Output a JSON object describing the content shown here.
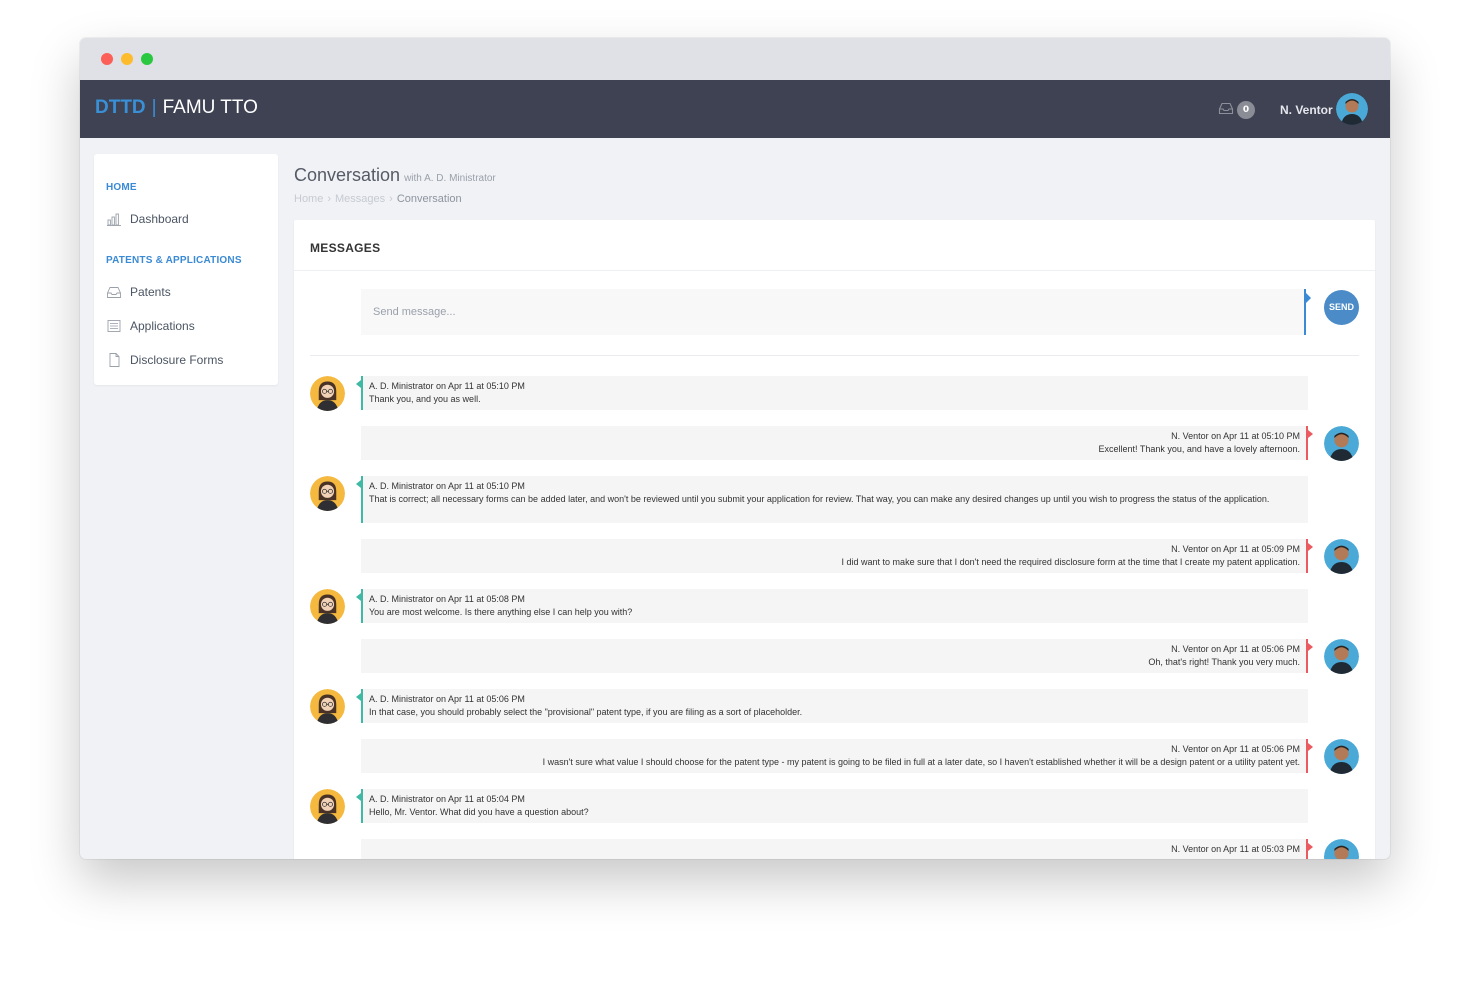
{
  "window": {
    "controls": [
      "close",
      "minimize",
      "maximize"
    ]
  },
  "navbar": {
    "brand_primary": "DTTD",
    "brand_separator": "|",
    "brand_secondary": "FAMU TTO",
    "inbox_icon": "inbox-icon",
    "inbox_count": "0",
    "user_name": "N. Ventor"
  },
  "sidebar": {
    "sections": [
      {
        "title": "HOME",
        "items": [
          {
            "label": "Dashboard",
            "icon": "bar-chart-icon"
          }
        ]
      },
      {
        "title": "PATENTS & APPLICATIONS",
        "items": [
          {
            "label": "Patents",
            "icon": "inbox-icon"
          },
          {
            "label": "Applications",
            "icon": "newspaper-icon"
          },
          {
            "label": "Disclosure Forms",
            "icon": "document-icon"
          }
        ]
      }
    ]
  },
  "page": {
    "title": "Conversation",
    "subtitle": "with A. D. Ministrator",
    "breadcrumb": [
      "Home",
      "Messages",
      "Conversation"
    ]
  },
  "panel": {
    "title": "MESSAGES",
    "compose_placeholder": "Send message...",
    "send_label": "SEND"
  },
  "colors": {
    "navbar": "#3e4253",
    "brand_blue": "#3a90d6",
    "received_accent": "#3fb9a4",
    "sent_accent": "#ea5a5f",
    "send_button": "#4a8bc8"
  },
  "messages": [
    {
      "side": "left",
      "meta": "A. D. Ministrator on Apr 11 at 05:10 PM",
      "text": "Thank you, and you as well."
    },
    {
      "side": "right",
      "meta": "N. Ventor on Apr 11 at 05:10 PM",
      "text": "Excellent! Thank you, and have a lovely afternoon."
    },
    {
      "side": "left",
      "meta": "A. D. Ministrator on Apr 11 at 05:10 PM",
      "text": "That is correct; all necessary forms can be added later, and won't be reviewed until you submit your application for review. That way, you can make any desired changes up until you wish to progress the status of the application."
    },
    {
      "side": "right",
      "meta": "N. Ventor on Apr 11 at 05:09 PM",
      "text": "I did want to make sure that I don't need the required disclosure form at the time that I create my patent application."
    },
    {
      "side": "left",
      "meta": "A. D. Ministrator on Apr 11 at 05:08 PM",
      "text": "You are most welcome. Is there anything else I can help you with?"
    },
    {
      "side": "right",
      "meta": "N. Ventor on Apr 11 at 05:06 PM",
      "text": "Oh, that's right! Thank you very much."
    },
    {
      "side": "left",
      "meta": "A. D. Ministrator on Apr 11 at 05:06 PM",
      "text": "In that case, you should probably select the \"provisional\" patent type, if you are filing as a sort of placeholder."
    },
    {
      "side": "right",
      "meta": "N. Ventor on Apr 11 at 05:06 PM",
      "text": "I wasn't sure what value I should choose for the patent type - my patent is going to be filed in full at a later date, so I haven't established whether it will be a design patent or a utility patent yet."
    },
    {
      "side": "left",
      "meta": "A. D. Ministrator on Apr 11 at 05:04 PM",
      "text": "Hello, Mr. Ventor. What did you have a question about?"
    },
    {
      "side": "right",
      "meta": "N. Ventor on Apr 11 at 05:03 PM",
      "text": ""
    }
  ]
}
